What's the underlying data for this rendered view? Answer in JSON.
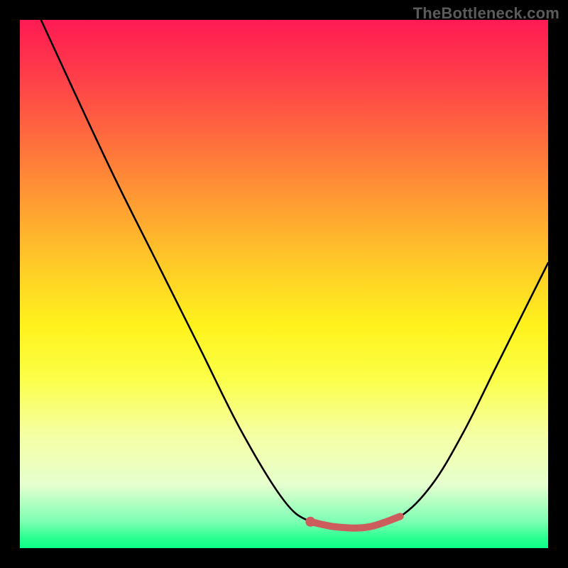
{
  "watermark": "TheBottleneck.com",
  "chart_data": {
    "type": "line",
    "title": "",
    "xlabel": "",
    "ylabel": "",
    "xlim": [
      0,
      100
    ],
    "ylim": [
      0,
      100
    ],
    "series": [
      {
        "name": "black-curve",
        "stroke": "#000000",
        "points": [
          {
            "x": 4,
            "y": 100
          },
          {
            "x": 10,
            "y": 87
          },
          {
            "x": 18,
            "y": 70
          },
          {
            "x": 26,
            "y": 54
          },
          {
            "x": 34,
            "y": 38
          },
          {
            "x": 42,
            "y": 22
          },
          {
            "x": 50,
            "y": 9
          },
          {
            "x": 55,
            "y": 5
          },
          {
            "x": 60,
            "y": 4
          },
          {
            "x": 66,
            "y": 4
          },
          {
            "x": 72,
            "y": 6
          },
          {
            "x": 78,
            "y": 12
          },
          {
            "x": 84,
            "y": 22
          },
          {
            "x": 90,
            "y": 34
          },
          {
            "x": 96,
            "y": 46
          },
          {
            "x": 100,
            "y": 54
          }
        ]
      },
      {
        "name": "highlight-segment",
        "stroke": "#cd5c5c",
        "points": [
          {
            "x": 55,
            "y": 5
          },
          {
            "x": 60,
            "y": 4
          },
          {
            "x": 66,
            "y": 4
          },
          {
            "x": 72,
            "y": 6
          }
        ]
      }
    ],
    "highlight_dot": {
      "x": 55,
      "y": 5,
      "fill": "#cd5c5c"
    }
  }
}
